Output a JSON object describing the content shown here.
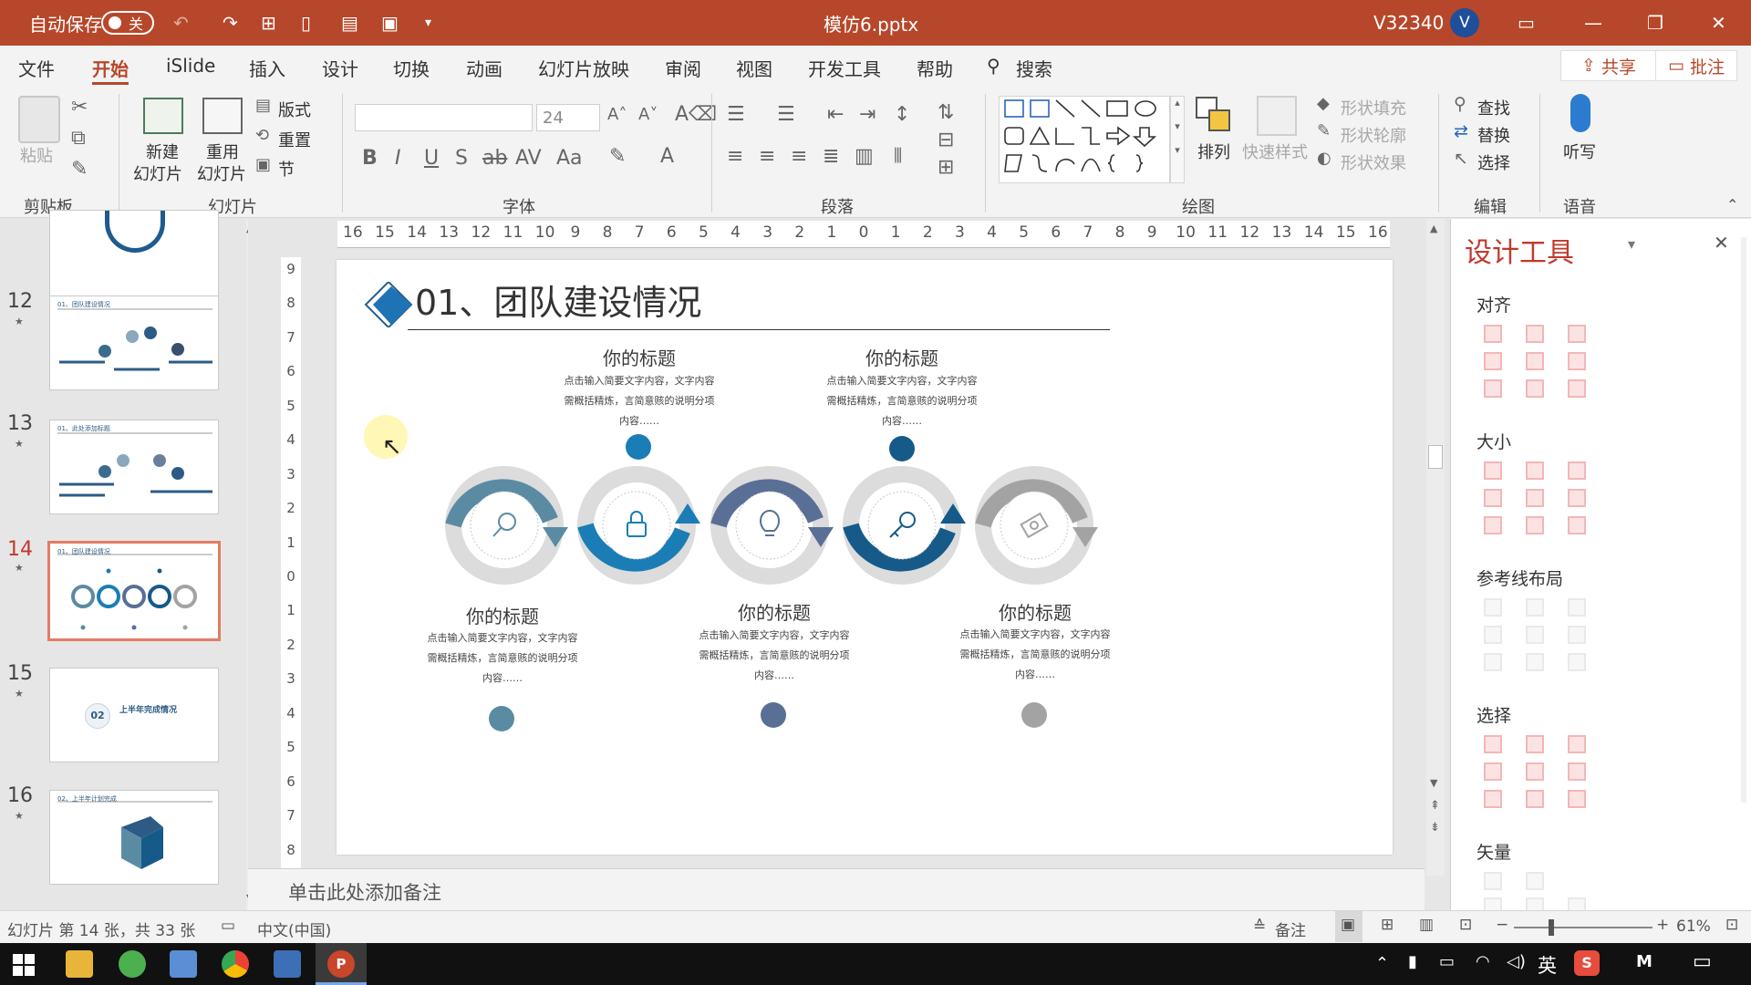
{
  "titlebar": {
    "autosave_label": "自动保存",
    "autosave_state": "关",
    "filename": "模仿6.pptx",
    "user": "V32340",
    "avatar_letter": "V"
  },
  "menu": {
    "tabs": [
      "文件",
      "开始",
      "iSlide",
      "插入",
      "设计",
      "切换",
      "动画",
      "幻灯片放映",
      "审阅",
      "视图",
      "开发工具",
      "帮助"
    ],
    "search": "搜索",
    "share": "共享",
    "comment": "批注"
  },
  "ribbon": {
    "clipboard": {
      "paste": "粘贴",
      "label": "剪贴板"
    },
    "slides": {
      "new1": "新建",
      "new2": "幻灯片",
      "reuse1": "重用",
      "reuse2": "幻灯片",
      "layout": "版式",
      "reset": "重置",
      "section": "节",
      "label": "幻灯片"
    },
    "font": {
      "size": "24",
      "label": "字体"
    },
    "paragraph": {
      "label": "段落"
    },
    "drawing": {
      "arrange": "排列",
      "quick_styles": "快速样式",
      "fill": "形状填充",
      "outline": "形状轮廓",
      "effects": "形状效果",
      "label": "绘图"
    },
    "editing": {
      "find": "查找",
      "replace": "替换",
      "select": "选择",
      "label": "编辑"
    },
    "voice": {
      "dictate": "听写",
      "label": "语音"
    }
  },
  "ruler": {
    "h_ticks": [
      "16",
      "15",
      "14",
      "13",
      "12",
      "11",
      "10",
      "9",
      "8",
      "7",
      "6",
      "5",
      "4",
      "3",
      "2",
      "1",
      "0",
      "1",
      "2",
      "3",
      "4",
      "5",
      "6",
      "7",
      "8",
      "9",
      "10",
      "11",
      "12",
      "13",
      "14",
      "15",
      "16"
    ],
    "v_ticks": [
      "9",
      "8",
      "7",
      "6",
      "5",
      "4",
      "3",
      "2",
      "1",
      "0",
      "1",
      "2",
      "3",
      "4",
      "5",
      "6",
      "7",
      "8",
      "9"
    ]
  },
  "thumbnails": [
    {
      "num": "",
      "title": ""
    },
    {
      "num": "12",
      "title": "01、团队建设情况"
    },
    {
      "num": "13",
      "title": "01、此处添加标题"
    },
    {
      "num": "14",
      "title": "01、团队建设情况"
    },
    {
      "num": "15",
      "title": "02"
    },
    {
      "num": "16",
      "title": "02、上半年计划完成"
    }
  ],
  "thumb15": {
    "num": "02",
    "title": "上半年完成情况"
  },
  "slide": {
    "title": "01、团队建设情况",
    "items": [
      {
        "title": "你的标题",
        "desc1": "点击输入简要文字内容，文字内容",
        "desc2": "需概括精炼，言简意赅的说明分项",
        "desc3": "内容……",
        "icon": "magnifier-icon",
        "color": "#5b8ba3"
      },
      {
        "title": "你的标题",
        "desc1": "点击输入简要文字内容，文字内容",
        "desc2": "需概括精炼，言简意赅的说明分项",
        "desc3": "内容……",
        "icon": "lock-icon",
        "color": "#1a7db5"
      },
      {
        "title": "你的标题",
        "desc1": "点击输入简要文字内容，文字内容",
        "desc2": "需概括精炼，言简意赅的说明分项",
        "desc3": "内容……",
        "icon": "lightbulb-icon",
        "color": "#5a6f96"
      },
      {
        "title": "你的标题",
        "desc1": "点击输入简要文字内容，文字内容",
        "desc2": "需概括精炼，言简意赅的说明分项",
        "desc3": "内容……",
        "icon": "key-icon",
        "color": "#165a8a"
      },
      {
        "title": "你的标题",
        "desc1": "点击输入简要文字内容，文字内容",
        "desc2": "需概括精炼，言简意赅的说明分项",
        "desc3": "内容……",
        "icon": "money-icon",
        "color": "#a3a3a3"
      }
    ]
  },
  "notes_placeholder": "单击此处添加备注",
  "pane": {
    "title": "设计工具",
    "sections": [
      "对齐",
      "大小",
      "参考线布局",
      "选择",
      "矢量"
    ]
  },
  "status": {
    "slide_info": "幻灯片 第 14 张，共 33 张",
    "language": "中文(中国)",
    "notes": "备注",
    "zoom": "61%"
  },
  "taskbar": {
    "ime": "英"
  },
  "colors": {
    "accent": "#b7472a",
    "pane_title": "#c0392b"
  }
}
